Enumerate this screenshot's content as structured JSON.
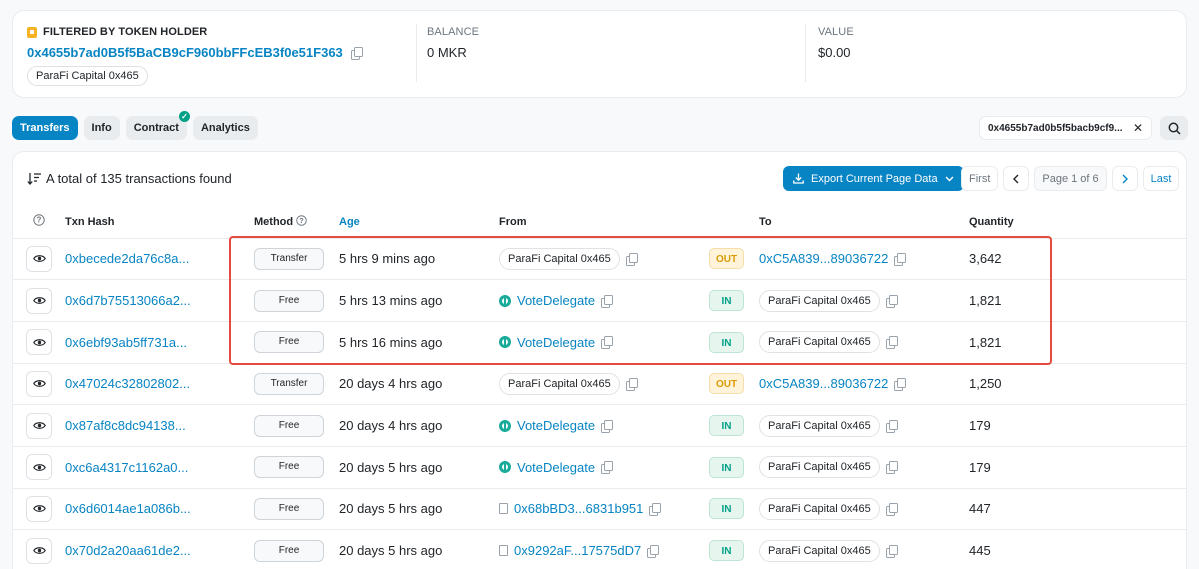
{
  "filter": {
    "label": "FILTERED BY TOKEN HOLDER",
    "address": "0x4655b7ad0B5f5BaCB9cF960bbFFcEB3f0e51F363",
    "tag": "ParaFi Capital 0x465",
    "balance_label": "BALANCE",
    "balance_value": "0 MKR",
    "value_label": "VALUE",
    "value_value": "$0.00"
  },
  "tabs": [
    {
      "label": "Transfers",
      "active": true
    },
    {
      "label": "Info"
    },
    {
      "label": "Contract",
      "verified": true
    },
    {
      "label": "Analytics"
    }
  ],
  "address_filter": "0x4655b7ad0b5f5bacb9cf9...",
  "summary": "A total of 135 transactions found",
  "export_label": "Export Current Page Data",
  "pager": {
    "first": "First",
    "info": "Page 1 of 6",
    "last": "Last"
  },
  "columns": {
    "hash": "Txn Hash",
    "method": "Method",
    "age": "Age",
    "from": "From",
    "to": "To",
    "quantity": "Quantity"
  },
  "rows": [
    {
      "hash": "0xbecede2da76c8a...",
      "method": "Transfer",
      "age": "5 hrs 9 mins ago",
      "from": "ParaFi Capital 0x465",
      "from_type": "pill",
      "dir": "OUT",
      "to": "0xC5A839...89036722",
      "to_type": "link",
      "qty": "3,642"
    },
    {
      "hash": "0x6d7b75513066a2...",
      "method": "Free",
      "age": "5 hrs 13 mins ago",
      "from": "VoteDelegate",
      "from_type": "vd",
      "dir": "IN",
      "to": "ParaFi Capital 0x465",
      "to_type": "pill",
      "qty": "1,821"
    },
    {
      "hash": "0x6ebf93ab5ff731a...",
      "method": "Free",
      "age": "5 hrs 16 mins ago",
      "from": "VoteDelegate",
      "from_type": "vd",
      "dir": "IN",
      "to": "ParaFi Capital 0x465",
      "to_type": "pill",
      "qty": "1,821"
    },
    {
      "hash": "0x47024c32802802...",
      "method": "Transfer",
      "age": "20 days 4 hrs ago",
      "from": "ParaFi Capital 0x465",
      "from_type": "pill",
      "dir": "OUT",
      "to": "0xC5A839...89036722",
      "to_type": "link",
      "qty": "1,250"
    },
    {
      "hash": "0x87af8c8dc94138...",
      "method": "Free",
      "age": "20 days 4 hrs ago",
      "from": "VoteDelegate",
      "from_type": "vd",
      "dir": "IN",
      "to": "ParaFi Capital 0x465",
      "to_type": "pill",
      "qty": "179"
    },
    {
      "hash": "0xc6a4317c1162a0...",
      "method": "Free",
      "age": "20 days 5 hrs ago",
      "from": "VoteDelegate",
      "from_type": "vd",
      "dir": "IN",
      "to": "ParaFi Capital 0x465",
      "to_type": "pill",
      "qty": "179"
    },
    {
      "hash": "0x6d6014ae1a086b...",
      "method": "Free",
      "age": "20 days 5 hrs ago",
      "from": "0x68bBD3...6831b951",
      "from_type": "doc",
      "dir": "IN",
      "to": "ParaFi Capital 0x465",
      "to_type": "pill",
      "qty": "447"
    },
    {
      "hash": "0x70d2a20aa61de2...",
      "method": "Free",
      "age": "20 days 5 hrs ago",
      "from": "0x9292aF...17575dD7",
      "from_type": "doc",
      "dir": "IN",
      "to": "ParaFi Capital 0x465",
      "to_type": "pill",
      "qty": "445"
    }
  ]
}
